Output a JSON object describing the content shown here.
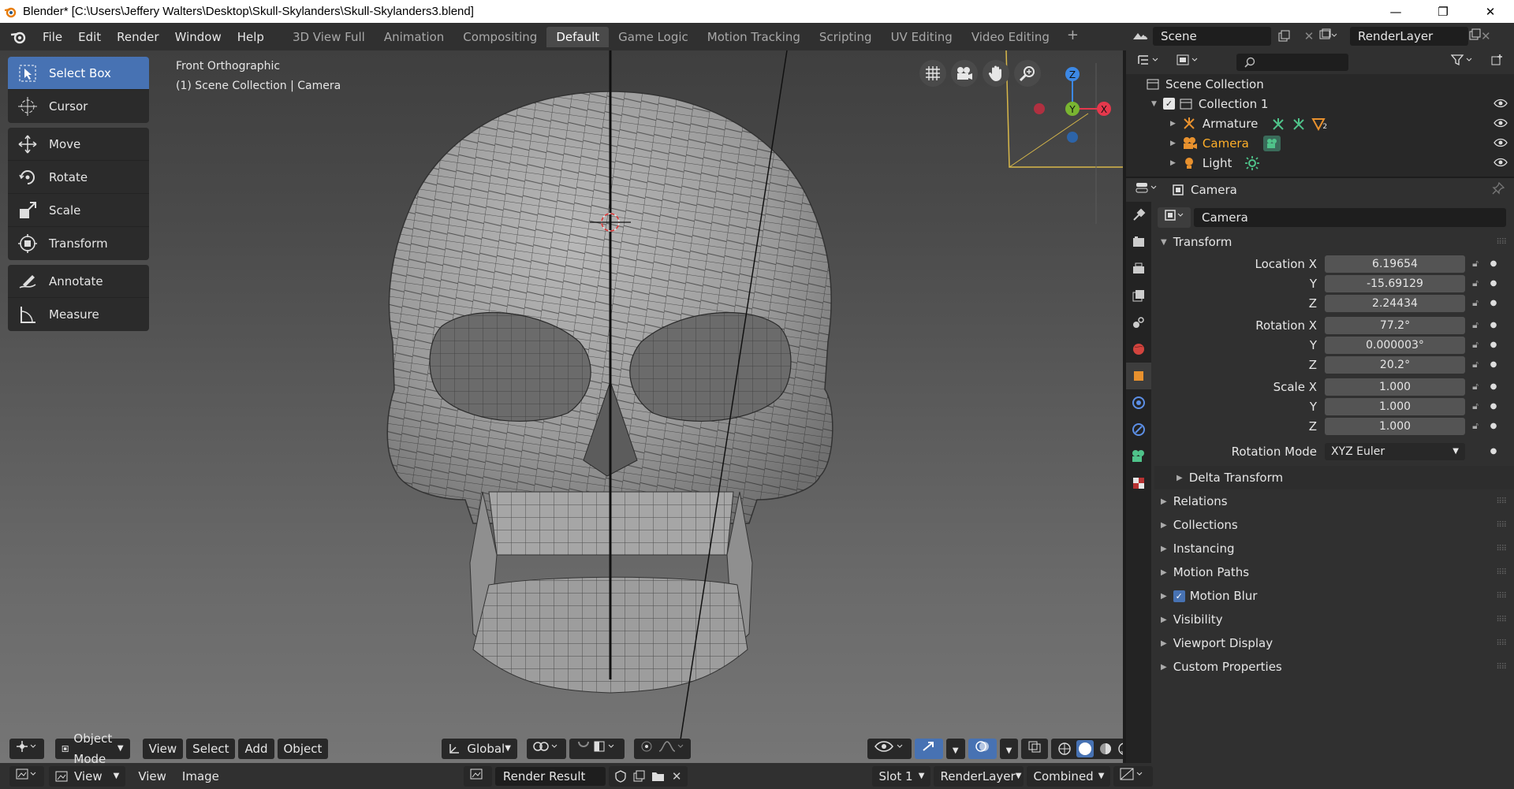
{
  "window": {
    "title": "Blender* [C:\\Users\\Jeffery Walters\\Desktop\\Skull-Skylanders\\Skull-Skylanders3.blend]",
    "minimize": "—",
    "maximize": "❐",
    "close": "✕"
  },
  "menubar": {
    "items": [
      "File",
      "Edit",
      "Render",
      "Window",
      "Help"
    ]
  },
  "workspaces": {
    "tabs": [
      "3D View Full",
      "Animation",
      "Compositing",
      "Default",
      "Game Logic",
      "Motion Tracking",
      "Scripting",
      "UV Editing",
      "Video Editing"
    ],
    "active": "Default",
    "add": "+"
  },
  "scene": {
    "name": "Scene"
  },
  "render_layer": {
    "name": "RenderLayer"
  },
  "viewport": {
    "view_name": "Front Orthographic",
    "context": "(1) Scene Collection | Camera",
    "tools": [
      "Select Box",
      "Cursor",
      "Move",
      "Rotate",
      "Scale",
      "Transform",
      "Annotate",
      "Measure"
    ],
    "active_tool": "Select Box",
    "gizmo": {
      "x": "X",
      "y": "Y",
      "z": "Z"
    },
    "header": {
      "mode": "Object Mode",
      "view": "View",
      "select": "Select",
      "add": "Add",
      "object": "Object",
      "orientation": "Global"
    }
  },
  "image_editor": {
    "view": "View",
    "view2": "View",
    "image": "Image",
    "image_name": "Render Result",
    "slot": "Slot 1",
    "layer": "RenderLayer",
    "pass": "Combined"
  },
  "outliner": {
    "root": "Scene Collection",
    "collection": "Collection 1",
    "objects": [
      "Armature",
      "Camera",
      "Light"
    ],
    "selected": "Camera",
    "armature_badge": "2"
  },
  "properties": {
    "header_object": "Camera",
    "object_name": "Camera",
    "transform_title": "Transform",
    "location": {
      "label": "Location X",
      "x": "6.19654",
      "y": "-15.69129",
      "z": "2.24434"
    },
    "rotation": {
      "label": "Rotation X",
      "x": "77.2°",
      "y": "0.000003°",
      "z": "20.2°"
    },
    "scale": {
      "label": "Scale X",
      "x": "1.000",
      "y": "1.000",
      "z": "1.000"
    },
    "axis_y": "Y",
    "axis_z": "Z",
    "rotation_mode_label": "Rotation Mode",
    "rotation_mode": "XYZ Euler",
    "delta_transform": "Delta Transform",
    "panels": [
      "Relations",
      "Collections",
      "Instancing",
      "Motion Paths",
      "Motion Blur",
      "Visibility",
      "Viewport Display",
      "Custom Properties"
    ]
  },
  "colors": {
    "accent": "#4772b3",
    "selected_object": "#ffaf29",
    "axis_x": "#e5384c",
    "axis_y": "#79b531",
    "axis_z": "#3c88e5"
  }
}
